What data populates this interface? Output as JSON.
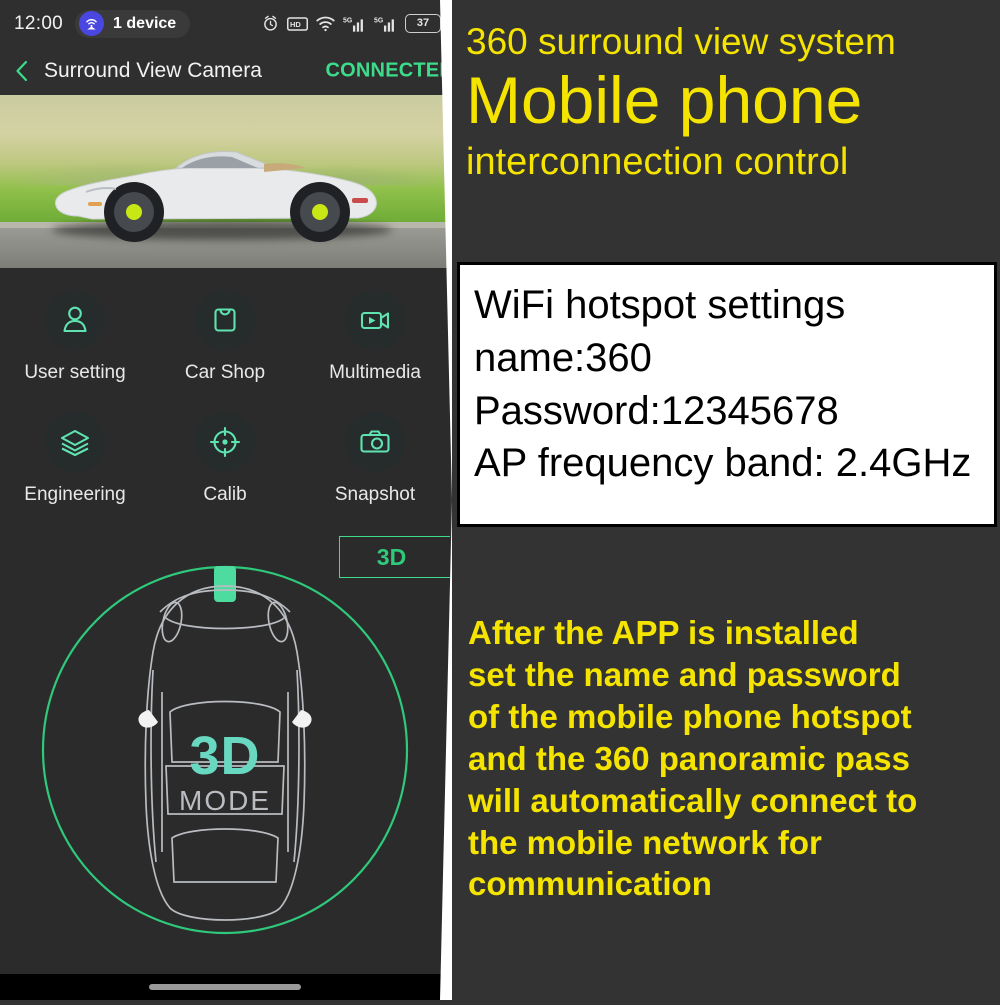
{
  "phone": {
    "status_bar": {
      "time": "12:00",
      "hotspot_label": "1 device",
      "hotspot_icon": "wifi-hotspot-icon",
      "icons": [
        "alarm-icon",
        "hd-icon",
        "wifi-icon",
        "5g-signal-icon",
        "5g-signal-icon-2"
      ],
      "battery_level": "37"
    },
    "app_bar": {
      "back_icon": "chevron-left-icon",
      "title": "Surround View Camera",
      "status": "CONNECTED",
      "status_color": "#3ddc8b"
    },
    "hero": {
      "alt": "white-convertible-sports-car-photo"
    },
    "menu": [
      [
        {
          "label": "User setting",
          "icon": "user-icon"
        },
        {
          "label": "Car Shop",
          "icon": "shopping-bag-icon"
        },
        {
          "label": "Multimedia",
          "icon": "video-camera-icon"
        }
      ],
      [
        {
          "label": "Engineering",
          "icon": "layers-icon"
        },
        {
          "label": "Calib",
          "icon": "crosshair-icon"
        },
        {
          "label": "Snapshot",
          "icon": "camera-icon"
        }
      ]
    ],
    "viewer": {
      "mode_button": "3D",
      "overlay_title": "3D",
      "overlay_subtitle": "MODE",
      "accent_color": "#3ddc8b",
      "car_outline_color": "#b9bcc0"
    }
  },
  "promo": {
    "headline_line1": "360 surround view system",
    "headline_line2": "Mobile phone",
    "headline_line3": "interconnection control",
    "headline_color": "#f5e400",
    "wifi_box": {
      "line1": "WiFi hotspot settings",
      "line2": "name:360",
      "line3": "Password:12345678",
      "line4": "AP frequency band: 2.4GHz"
    },
    "note": {
      "l1": "After the APP is installed",
      "l2": "set the name and password",
      "l3": "of the mobile phone hotspot",
      "l4": "and the 360 panoramic pass",
      "l5": "will automatically connect to",
      "l6": "the mobile network for",
      "l7": "communication"
    }
  }
}
